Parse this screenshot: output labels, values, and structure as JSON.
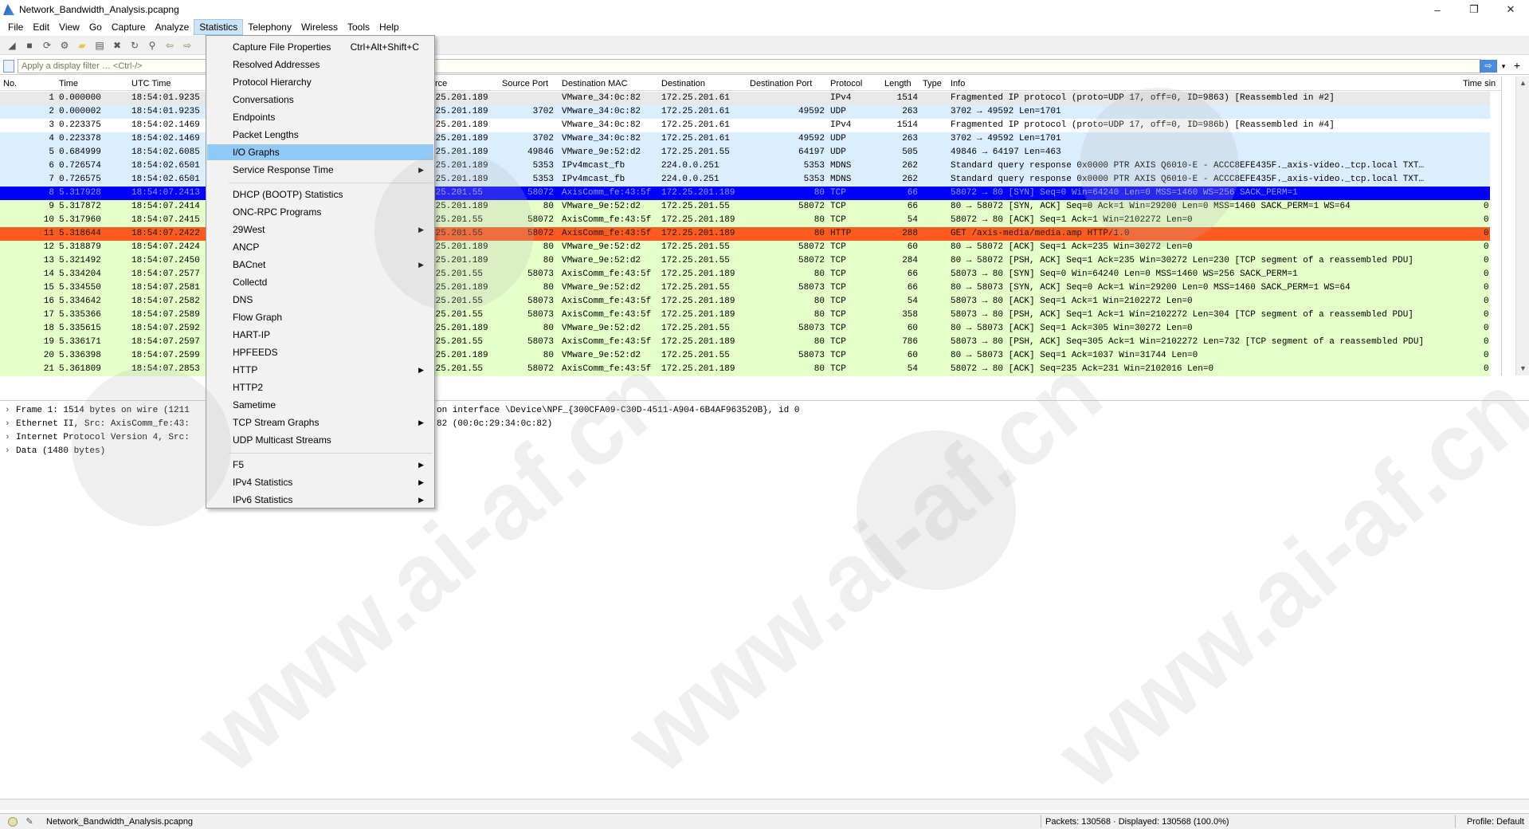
{
  "window": {
    "title": "Network_Bandwidth_Analysis.pcapng",
    "controls": {
      "minimize": "–",
      "restore": "❐",
      "close": "✕"
    }
  },
  "menubar": {
    "items": [
      "File",
      "Edit",
      "View",
      "Go",
      "Capture",
      "Analyze",
      "Statistics",
      "Telephony",
      "Wireless",
      "Tools",
      "Help"
    ],
    "active": "Statistics"
  },
  "filter": {
    "placeholder": "Apply a display filter … <Ctrl-/>",
    "apply_icon": "⇨",
    "dropdown_icon": "▾",
    "add_icon": "+"
  },
  "columns": {
    "no": "No.",
    "time": "Time",
    "utc": "UTC Time",
    "source": "rce",
    "sport": "Source Port",
    "dmac": "Destination MAC",
    "dst": "Destination",
    "dport": "Destination Port",
    "proto": "Protocol",
    "len": "Length",
    "type": "Type",
    "info": "Info",
    "tail": "Time sin"
  },
  "rows": [
    {
      "no": "1",
      "time": "0.000000",
      "utc": "18:54:01.9235",
      "src": ".25.201.189",
      "sport": "",
      "dmac": "VMware_34:0c:82",
      "dst": "172.25.201.61",
      "dport": "",
      "proto": "IPv4",
      "len": "1514",
      "info": "Fragmented IP protocol (proto=UDP 17, off=0, ID=9863) [Reassembled in #2]",
      "tail": "",
      "bg": "#e8e8e8",
      "fg": "#000000"
    },
    {
      "no": "2",
      "time": "0.000002",
      "utc": "18:54:01.9235",
      "src": ".25.201.189",
      "sport": "3702",
      "dmac": "VMware_34:0c:82",
      "dst": "172.25.201.61",
      "dport": "49592",
      "proto": "UDP",
      "len": "263",
      "info": "3702 → 49592 Len=1701",
      "tail": "",
      "bg": "#daeeff",
      "fg": "#000000"
    },
    {
      "no": "3",
      "time": "0.223375",
      "utc": "18:54:02.1469",
      "src": ".25.201.189",
      "sport": "",
      "dmac": "VMware_34:0c:82",
      "dst": "172.25.201.61",
      "dport": "",
      "proto": "IPv4",
      "len": "1514",
      "info": "Fragmented IP protocol (proto=UDP 17, off=0, ID=986b) [Reassembled in #4]",
      "tail": "",
      "bg": "#ffffff",
      "fg": "#000000"
    },
    {
      "no": "4",
      "time": "0.223378",
      "utc": "18:54:02.1469",
      "src": ".25.201.189",
      "sport": "3702",
      "dmac": "VMware_34:0c:82",
      "dst": "172.25.201.61",
      "dport": "49592",
      "proto": "UDP",
      "len": "263",
      "info": "3702 → 49592 Len=1701",
      "tail": "",
      "bg": "#daeeff",
      "fg": "#000000"
    },
    {
      "no": "5",
      "time": "0.684999",
      "utc": "18:54:02.6085",
      "src": ".25.201.189",
      "sport": "49846",
      "dmac": "VMware_9e:52:d2",
      "dst": "172.25.201.55",
      "dport": "64197",
      "proto": "UDP",
      "len": "505",
      "info": "49846 → 64197 Len=463",
      "tail": "",
      "bg": "#daeeff",
      "fg": "#000000"
    },
    {
      "no": "6",
      "time": "0.726574",
      "utc": "18:54:02.6501",
      "src": ".25.201.189",
      "sport": "5353",
      "dmac": "IPv4mcast_fb",
      "dst": "224.0.0.251",
      "dport": "5353",
      "proto": "MDNS",
      "len": "262",
      "info": "Standard query response 0x0000 PTR AXIS Q6010-E - ACCC8EFE435F._axis-video._tcp.local TXT…",
      "tail": "",
      "bg": "#daeeff",
      "fg": "#000000"
    },
    {
      "no": "7",
      "time": "0.726575",
      "utc": "18:54:02.6501",
      "src": ".25.201.189",
      "sport": "5353",
      "dmac": "IPv4mcast_fb",
      "dst": "224.0.0.251",
      "dport": "5353",
      "proto": "MDNS",
      "len": "262",
      "info": "Standard query response 0x0000 PTR AXIS Q6010-E - ACCC8EFE435F._axis-video._tcp.local TXT…",
      "tail": "",
      "bg": "#daeeff",
      "fg": "#000000"
    },
    {
      "no": "8",
      "time": "5.317928",
      "utc": "18:54:07.2413",
      "src": ".25.201.55",
      "sport": "58072",
      "dmac": "AxisComm_fe:43:5f",
      "dst": "172.25.201.189",
      "dport": "80",
      "proto": "TCP",
      "len": "66",
      "info": "58072 → 80 [SYN] Seq=0 Win=64240 Len=0 MSS=1460 WS=256 SACK_PERM=1",
      "tail": "",
      "bg": "#0000ff",
      "fg": "#9a9aff"
    },
    {
      "no": "9",
      "time": "5.317872",
      "utc": "18:54:07.2414",
      "src": ".25.201.189",
      "sport": "80",
      "dmac": "VMware_9e:52:d2",
      "dst": "172.25.201.55",
      "dport": "58072",
      "proto": "TCP",
      "len": "66",
      "info": "80 → 58072 [SYN, ACK] Seq=0 Ack=1 Win=29200 Len=0 MSS=1460 SACK_PERM=1 WS=64",
      "tail": "0.",
      "bg": "#e4ffc7",
      "fg": "#000000"
    },
    {
      "no": "10",
      "time": "5.317960",
      "utc": "18:54:07.2415",
      "src": ".25.201.55",
      "sport": "58072",
      "dmac": "AxisComm_fe:43:5f",
      "dst": "172.25.201.189",
      "dport": "80",
      "proto": "TCP",
      "len": "54",
      "info": "58072 → 80 [ACK] Seq=1 Ack=1 Win=2102272 Len=0",
      "tail": "0.",
      "bg": "#e4ffc7",
      "fg": "#000000"
    },
    {
      "no": "11",
      "time": "5.318644",
      "utc": "18:54:07.2422",
      "src": ".25.201.55",
      "sport": "58072",
      "dmac": "AxisComm_fe:43:5f",
      "dst": "172.25.201.189",
      "dport": "80",
      "proto": "HTTP",
      "len": "288",
      "info": "GET /axis-media/media.amp HTTP/1.0",
      "tail": "0.",
      "bg": "#ff5a1f",
      "fg": "#1a1a1a"
    },
    {
      "no": "12",
      "time": "5.318879",
      "utc": "18:54:07.2424",
      "src": ".25.201.189",
      "sport": "80",
      "dmac": "VMware_9e:52:d2",
      "dst": "172.25.201.55",
      "dport": "58072",
      "proto": "TCP",
      "len": "60",
      "info": "80 → 58072 [ACK] Seq=1 Ack=235 Win=30272 Len=0",
      "tail": "0.",
      "bg": "#e4ffc7",
      "fg": "#000000"
    },
    {
      "no": "13",
      "time": "5.321492",
      "utc": "18:54:07.2450",
      "src": ".25.201.189",
      "sport": "80",
      "dmac": "VMware_9e:52:d2",
      "dst": "172.25.201.55",
      "dport": "58072",
      "proto": "TCP",
      "len": "284",
      "info": "80 → 58072 [PSH, ACK] Seq=1 Ack=235 Win=30272 Len=230 [TCP segment of a reassembled PDU]",
      "tail": "0.",
      "bg": "#e4ffc7",
      "fg": "#000000"
    },
    {
      "no": "14",
      "time": "5.334204",
      "utc": "18:54:07.2577",
      "src": ".25.201.55",
      "sport": "58073",
      "dmac": "AxisComm_fe:43:5f",
      "dst": "172.25.201.189",
      "dport": "80",
      "proto": "TCP",
      "len": "66",
      "info": "58073 → 80 [SYN] Seq=0 Win=64240 Len=0 MSS=1460 WS=256 SACK_PERM=1",
      "tail": "0.",
      "bg": "#e4ffc7",
      "fg": "#000000"
    },
    {
      "no": "15",
      "time": "5.334550",
      "utc": "18:54:07.2581",
      "src": ".25.201.189",
      "sport": "80",
      "dmac": "VMware_9e:52:d2",
      "dst": "172.25.201.55",
      "dport": "58073",
      "proto": "TCP",
      "len": "66",
      "info": "80 → 58073 [SYN, ACK] Seq=0 Ack=1 Win=29200 Len=0 MSS=1460 SACK_PERM=1 WS=64",
      "tail": "0.",
      "bg": "#e4ffc7",
      "fg": "#000000"
    },
    {
      "no": "16",
      "time": "5.334642",
      "utc": "18:54:07.2582",
      "src": ".25.201.55",
      "sport": "58073",
      "dmac": "AxisComm_fe:43:5f",
      "dst": "172.25.201.189",
      "dport": "80",
      "proto": "TCP",
      "len": "54",
      "info": "58073 → 80 [ACK] Seq=1 Ack=1 Win=2102272 Len=0",
      "tail": "0.",
      "bg": "#e4ffc7",
      "fg": "#000000"
    },
    {
      "no": "17",
      "time": "5.335366",
      "utc": "18:54:07.2589",
      "src": ".25.201.55",
      "sport": "58073",
      "dmac": "AxisComm_fe:43:5f",
      "dst": "172.25.201.189",
      "dport": "80",
      "proto": "TCP",
      "len": "358",
      "info": "58073 → 80 [PSH, ACK] Seq=1 Ack=1 Win=2102272 Len=304 [TCP segment of a reassembled PDU]",
      "tail": "0.",
      "bg": "#e4ffc7",
      "fg": "#000000"
    },
    {
      "no": "18",
      "time": "5.335615",
      "utc": "18:54:07.2592",
      "src": ".25.201.189",
      "sport": "80",
      "dmac": "VMware_9e:52:d2",
      "dst": "172.25.201.55",
      "dport": "58073",
      "proto": "TCP",
      "len": "60",
      "info": "80 → 58073 [ACK] Seq=1 Ack=305 Win=30272 Len=0",
      "tail": "0.",
      "bg": "#e4ffc7",
      "fg": "#000000"
    },
    {
      "no": "19",
      "time": "5.336171",
      "utc": "18:54:07.2597",
      "src": ".25.201.55",
      "sport": "58073",
      "dmac": "AxisComm_fe:43:5f",
      "dst": "172.25.201.189",
      "dport": "80",
      "proto": "TCP",
      "len": "786",
      "info": "58073 → 80 [PSH, ACK] Seq=305 Ack=1 Win=2102272 Len=732 [TCP segment of a reassembled PDU]",
      "tail": "0.",
      "bg": "#e4ffc7",
      "fg": "#000000"
    },
    {
      "no": "20",
      "time": "5.336398",
      "utc": "18:54:07.2599",
      "src": ".25.201.189",
      "sport": "80",
      "dmac": "VMware_9e:52:d2",
      "dst": "172.25.201.55",
      "dport": "58073",
      "proto": "TCP",
      "len": "60",
      "info": "80 → 58073 [ACK] Seq=1 Ack=1037 Win=31744 Len=0",
      "tail": "0.",
      "bg": "#e4ffc7",
      "fg": "#000000"
    },
    {
      "no": "21",
      "time": "5.361809",
      "utc": "18:54:07.2853",
      "src": ".25.201.55",
      "sport": "58072",
      "dmac": "AxisComm_fe:43:5f",
      "dst": "172.25.201.189",
      "dport": "80",
      "proto": "TCP",
      "len": "54",
      "info": "58072 → 80 [ACK] Seq=235 Ack=231 Win=2102016 Len=0",
      "tail": "0.",
      "bg": "#e4ffc7",
      "fg": "#000000"
    }
  ],
  "details": [
    "Frame 1: 1514 bytes on wire (1211",
    "Ethernet II, Src: AxisComm_fe:43:",
    "Internet Protocol Version 4, Src:",
    "Data (1480 bytes)"
  ],
  "details_tail": [
    "on interface \\Device\\NPF_{300CFA09-C30D-4511-A904-6B4AF963520B}, id 0",
    "82 (00:0c:29:34:0c:82)"
  ],
  "statistics_menu": [
    {
      "label": "Capture File Properties",
      "shortcut": "Ctrl+Alt+Shift+C",
      "submenu": false
    },
    {
      "label": "Resolved Addresses",
      "shortcut": "",
      "submenu": false
    },
    {
      "label": "Protocol Hierarchy",
      "shortcut": "",
      "submenu": false
    },
    {
      "label": "Conversations",
      "shortcut": "",
      "submenu": false
    },
    {
      "label": "Endpoints",
      "shortcut": "",
      "submenu": false
    },
    {
      "label": "Packet Lengths",
      "shortcut": "",
      "submenu": false
    },
    {
      "label": "I/O Graphs",
      "shortcut": "",
      "submenu": false,
      "highlighted": true
    },
    {
      "label": "Service Response Time",
      "shortcut": "",
      "submenu": true
    },
    {
      "separator": true
    },
    {
      "label": "DHCP (BOOTP) Statistics",
      "shortcut": "",
      "submenu": false
    },
    {
      "label": "ONC-RPC Programs",
      "shortcut": "",
      "submenu": false
    },
    {
      "label": "29West",
      "shortcut": "",
      "submenu": true
    },
    {
      "label": "ANCP",
      "shortcut": "",
      "submenu": false
    },
    {
      "label": "BACnet",
      "shortcut": "",
      "submenu": true
    },
    {
      "label": "Collectd",
      "shortcut": "",
      "submenu": false
    },
    {
      "label": "DNS",
      "shortcut": "",
      "submenu": false
    },
    {
      "label": "Flow Graph",
      "shortcut": "",
      "submenu": false
    },
    {
      "label": "HART-IP",
      "shortcut": "",
      "submenu": false
    },
    {
      "label": "HPFEEDS",
      "shortcut": "",
      "submenu": false
    },
    {
      "label": "HTTP",
      "shortcut": "",
      "submenu": true
    },
    {
      "label": "HTTP2",
      "shortcut": "",
      "submenu": false
    },
    {
      "label": "Sametime",
      "shortcut": "",
      "submenu": false
    },
    {
      "label": "TCP Stream Graphs",
      "shortcut": "",
      "submenu": true
    },
    {
      "label": "UDP Multicast Streams",
      "shortcut": "",
      "submenu": false
    },
    {
      "separator": true
    },
    {
      "label": "F5",
      "shortcut": "",
      "submenu": true
    },
    {
      "label": "IPv4 Statistics",
      "shortcut": "",
      "submenu": true
    },
    {
      "label": "IPv6 Statistics",
      "shortcut": "",
      "submenu": true
    }
  ],
  "statusbar": {
    "file": "Network_Bandwidth_Analysis.pcapng",
    "packets": "Packets: 130568 · Displayed: 130568 (100.0%)",
    "profile": "Profile: Default"
  },
  "watermark": {
    "text": "www.ai-af.cn",
    "logo_text": "ai-af",
    "color": "#b4b4b4"
  }
}
